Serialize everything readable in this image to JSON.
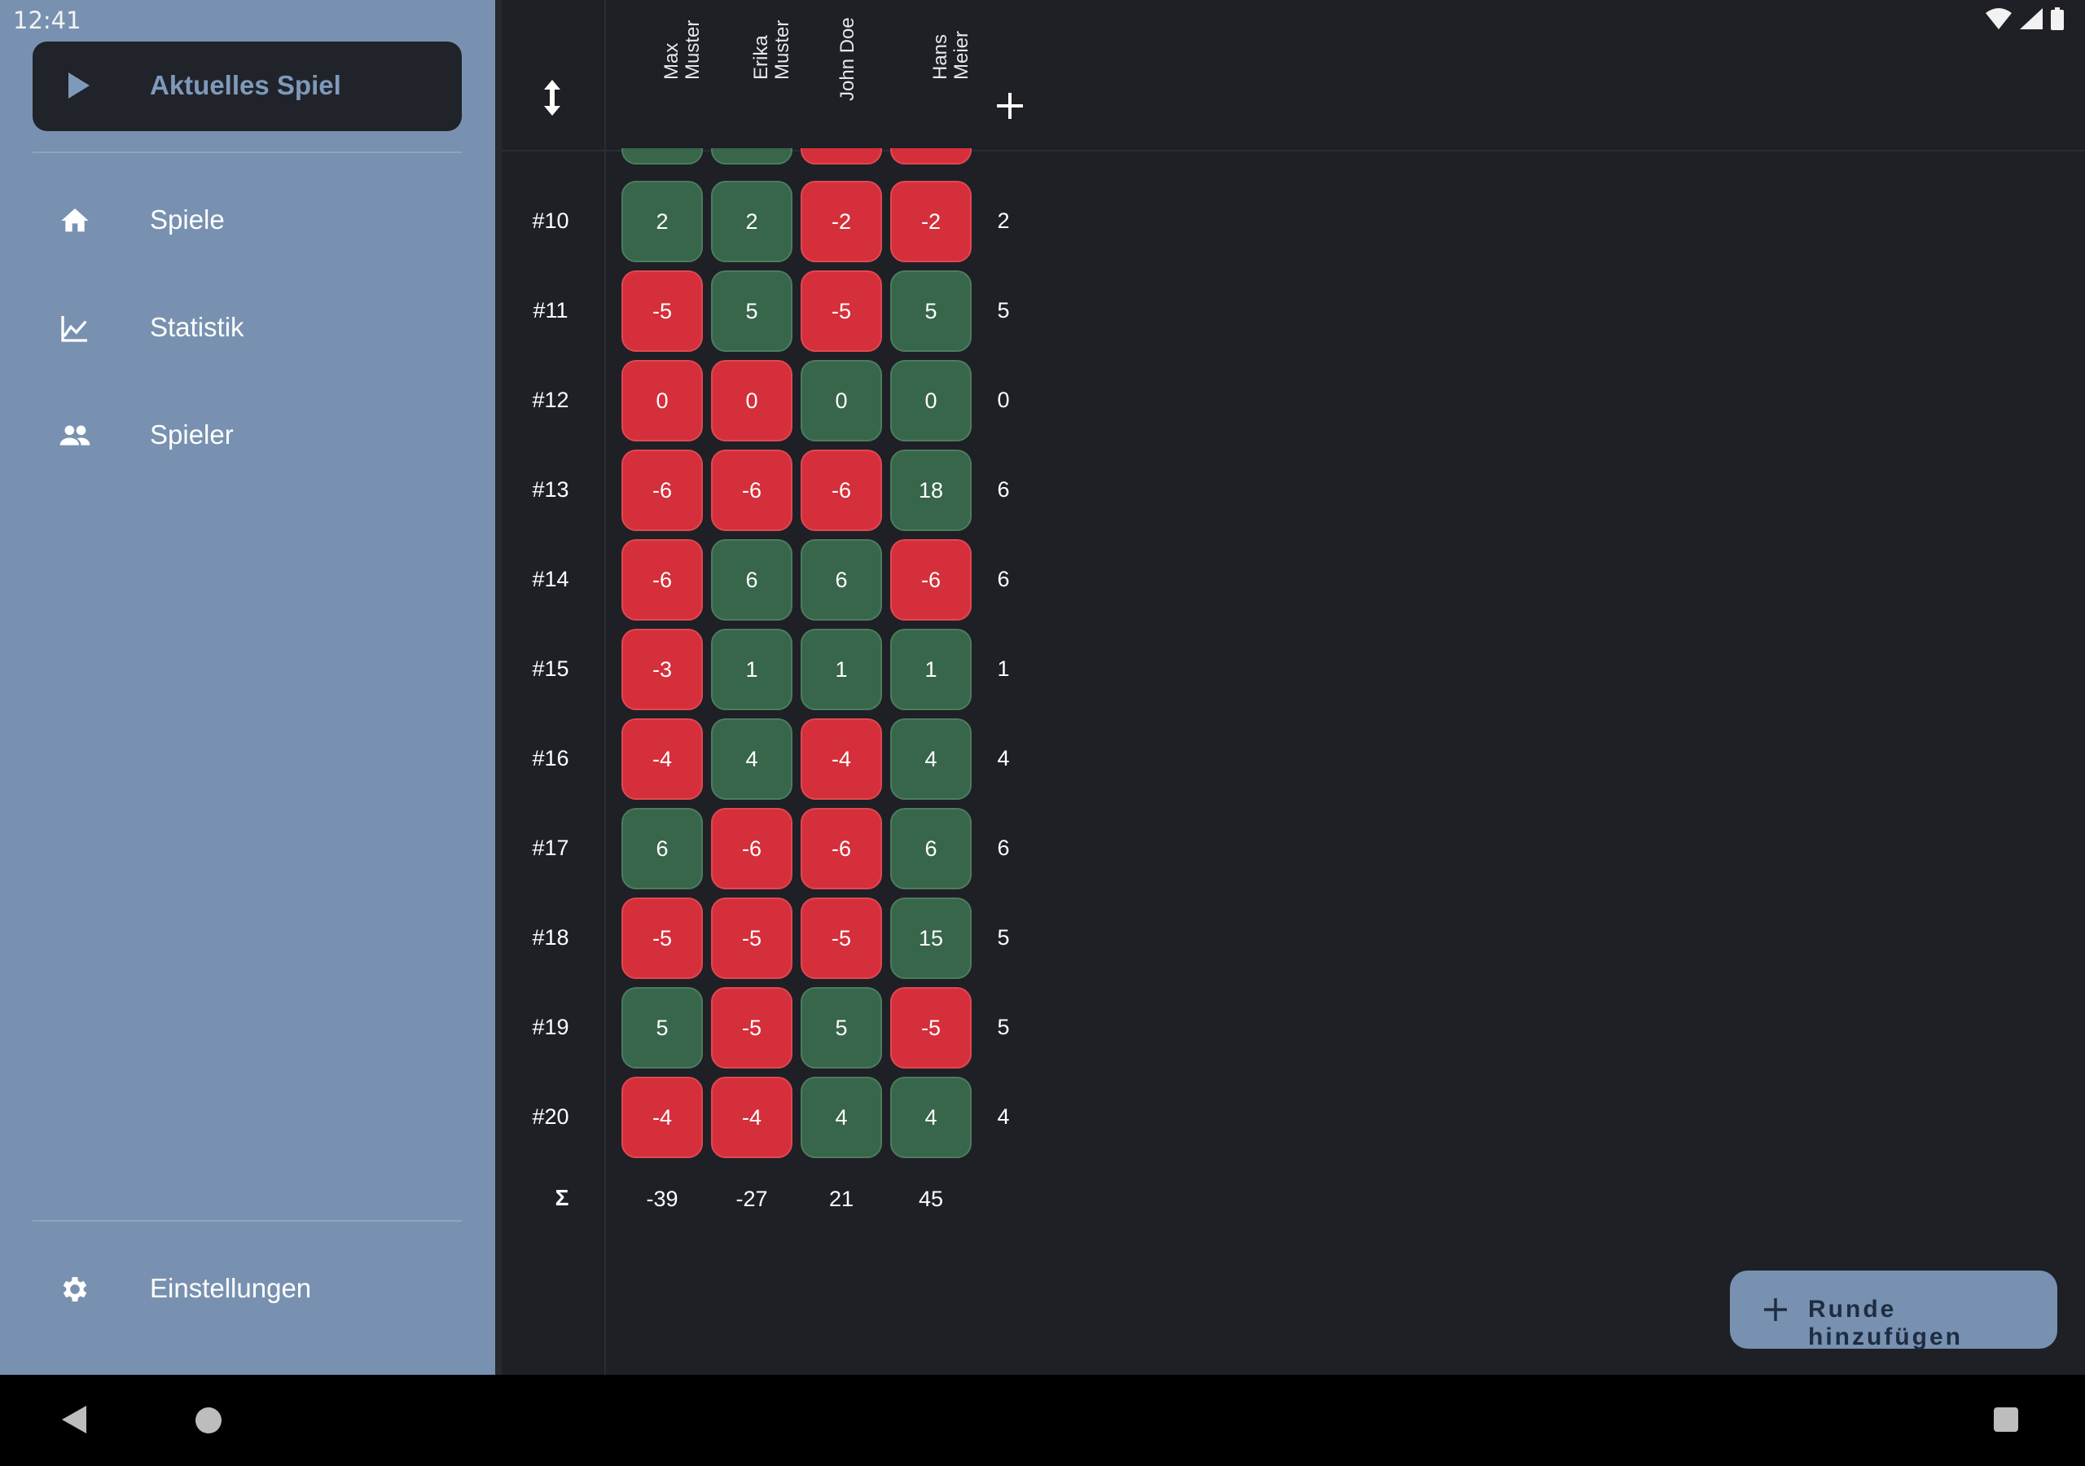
{
  "status_bar": {
    "time": "12:41"
  },
  "sidebar": {
    "current_game": {
      "label": "Aktuelles Spiel",
      "icon": "play-icon"
    },
    "items": [
      {
        "label": "Spiele",
        "icon": "home-icon"
      },
      {
        "label": "Statistik",
        "icon": "chart-line-icon"
      },
      {
        "label": "Spieler",
        "icon": "people-icon"
      }
    ],
    "settings": {
      "label": "Einstellungen",
      "icon": "gear-icon"
    }
  },
  "players": [
    {
      "line1": "Max",
      "line2": "Muster"
    },
    {
      "line1": "Erika",
      "line2": "Muster"
    },
    {
      "line1": "John Doe",
      "line2": ""
    },
    {
      "line1": "Hans",
      "line2": "Meier"
    }
  ],
  "rounds": [
    {
      "label": "#10",
      "scores": [
        2,
        2,
        -2,
        -2
      ],
      "total": "2"
    },
    {
      "label": "#11",
      "scores": [
        -5,
        5,
        -5,
        5
      ],
      "total": "5"
    },
    {
      "label": "#12",
      "scores": [
        0,
        0,
        0,
        0
      ],
      "total": "0"
    },
    {
      "label": "#13",
      "scores": [
        -6,
        -6,
        -6,
        18
      ],
      "total": "6"
    },
    {
      "label": "#14",
      "scores": [
        -6,
        6,
        6,
        -6
      ],
      "total": "6"
    },
    {
      "label": "#15",
      "scores": [
        -3,
        1,
        1,
        1
      ],
      "total": "1"
    },
    {
      "label": "#16",
      "scores": [
        -4,
        4,
        -4,
        4
      ],
      "total": "4"
    },
    {
      "label": "#17",
      "scores": [
        6,
        -6,
        -6,
        6
      ],
      "total": "6"
    },
    {
      "label": "#18",
      "scores": [
        -5,
        -5,
        -5,
        15
      ],
      "total": "5"
    },
    {
      "label": "#19",
      "scores": [
        5,
        -5,
        5,
        -5
      ],
      "total": "5"
    },
    {
      "label": "#20",
      "scores": [
        -4,
        -4,
        4,
        4
      ],
      "total": "4"
    }
  ],
  "winner_flags": [
    [
      true,
      true,
      false,
      false
    ],
    [
      false,
      true,
      false,
      true
    ],
    [
      false,
      false,
      true,
      true
    ],
    [
      false,
      false,
      false,
      true
    ],
    [
      false,
      true,
      true,
      false
    ],
    [
      false,
      true,
      true,
      true
    ],
    [
      false,
      true,
      false,
      true
    ],
    [
      true,
      false,
      false,
      true
    ],
    [
      false,
      false,
      false,
      true
    ],
    [
      true,
      false,
      true,
      false
    ],
    [
      false,
      false,
      true,
      true
    ]
  ],
  "sum": {
    "label": "Σ",
    "values": [
      "-39",
      "-27",
      "21",
      "45"
    ]
  },
  "fab": {
    "label": "Runde hinzufügen"
  },
  "colors": {
    "positive": "#37664b",
    "negative": "#d42f3a",
    "sidebar": "#7891b0",
    "background": "#1e2026"
  }
}
